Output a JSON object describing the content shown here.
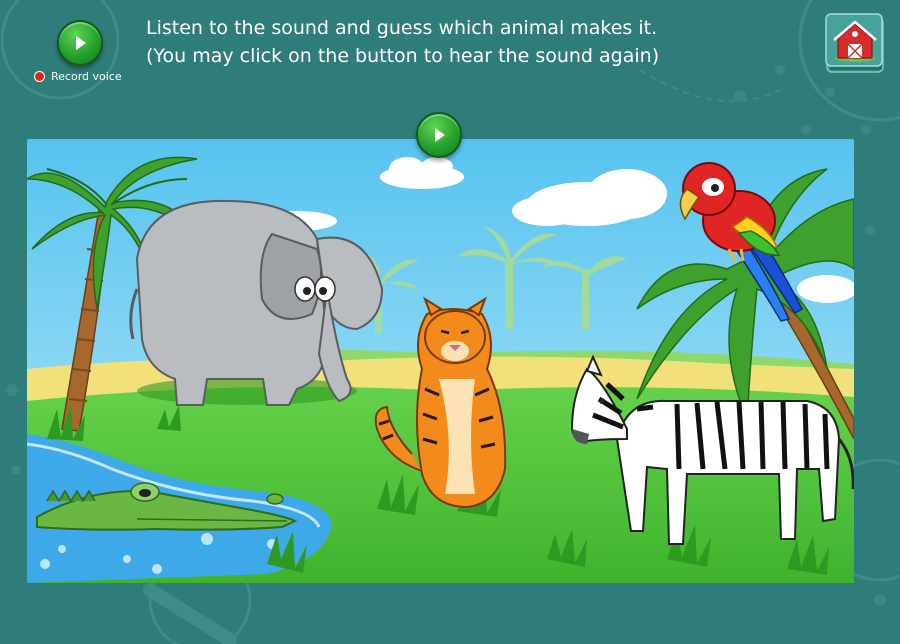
{
  "instruction": {
    "line1": "Listen to the sound and guess which animal makes it.",
    "line2": "(You may click on the button to hear the sound again)"
  },
  "controls": {
    "record_label": "Record voice",
    "play_icon": "play-icon",
    "barn_icon": "barn-icon"
  },
  "scene": {
    "animals": [
      "elephant",
      "crocodile",
      "tiger",
      "parrot",
      "zebra"
    ]
  },
  "colors": {
    "background": "#2f7d7a",
    "button_green": "#24a12d",
    "record_red": "#e2231a",
    "sky": "#7fd0f0",
    "grass": "#4cc73a",
    "water": "#3ea9e8"
  }
}
